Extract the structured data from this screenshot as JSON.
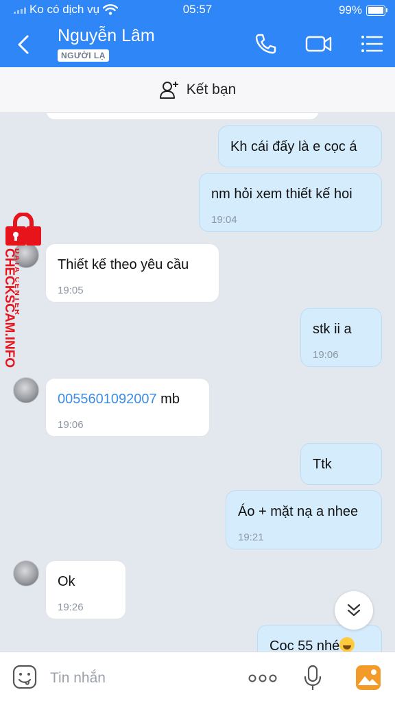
{
  "status_bar": {
    "carrier": "Ko có dịch vụ",
    "time": "05:57",
    "battery": "99%",
    "battery_level": 0.99
  },
  "header": {
    "contact_name": "Nguyễn Lâm",
    "badge": "NGƯỜI LẠ"
  },
  "add_friend": {
    "label": "Kết bạn"
  },
  "messages": [
    {
      "dir": "out",
      "text": "Kh cái đấy là e cọc á",
      "time": ""
    },
    {
      "dir": "out",
      "text": "nm hỏi xem thiết kế hoi",
      "time": "19:04"
    },
    {
      "dir": "in",
      "text": "Thiết kế theo yêu cầu",
      "time": "19:05"
    },
    {
      "dir": "out",
      "text": "stk ii a",
      "time": "19:06"
    },
    {
      "dir": "in",
      "text_link": "0055601092007",
      "text_after": " mb",
      "time": "19:06"
    },
    {
      "dir": "out",
      "text": "Ttk",
      "time": ""
    },
    {
      "dir": "out",
      "text": "Áo + mặt nạ a nhee",
      "time": "19:21"
    },
    {
      "dir": "in",
      "text": "Ok",
      "time": "19:26"
    },
    {
      "dir": "out",
      "text": "Coc 55 nhé",
      "time": ""
    }
  ],
  "watermark": {
    "line1": "DATA CENTER",
    "line2": "CHECKSCAM.INFO",
    "color": "#e8141c"
  },
  "input": {
    "placeholder": "Tin nhắn"
  },
  "colors": {
    "header": "#2f86f6",
    "bubble_out": "#d5ecfd",
    "bubble_in": "#ffffff",
    "link": "#3b8ee6"
  },
  "icons": [
    "back-icon",
    "phone-icon",
    "video-call-icon",
    "menu-icon",
    "add-friend-icon",
    "scroll-down-icon",
    "sticker-icon",
    "more-icon",
    "microphone-icon",
    "image-icon",
    "lock-icon"
  ]
}
